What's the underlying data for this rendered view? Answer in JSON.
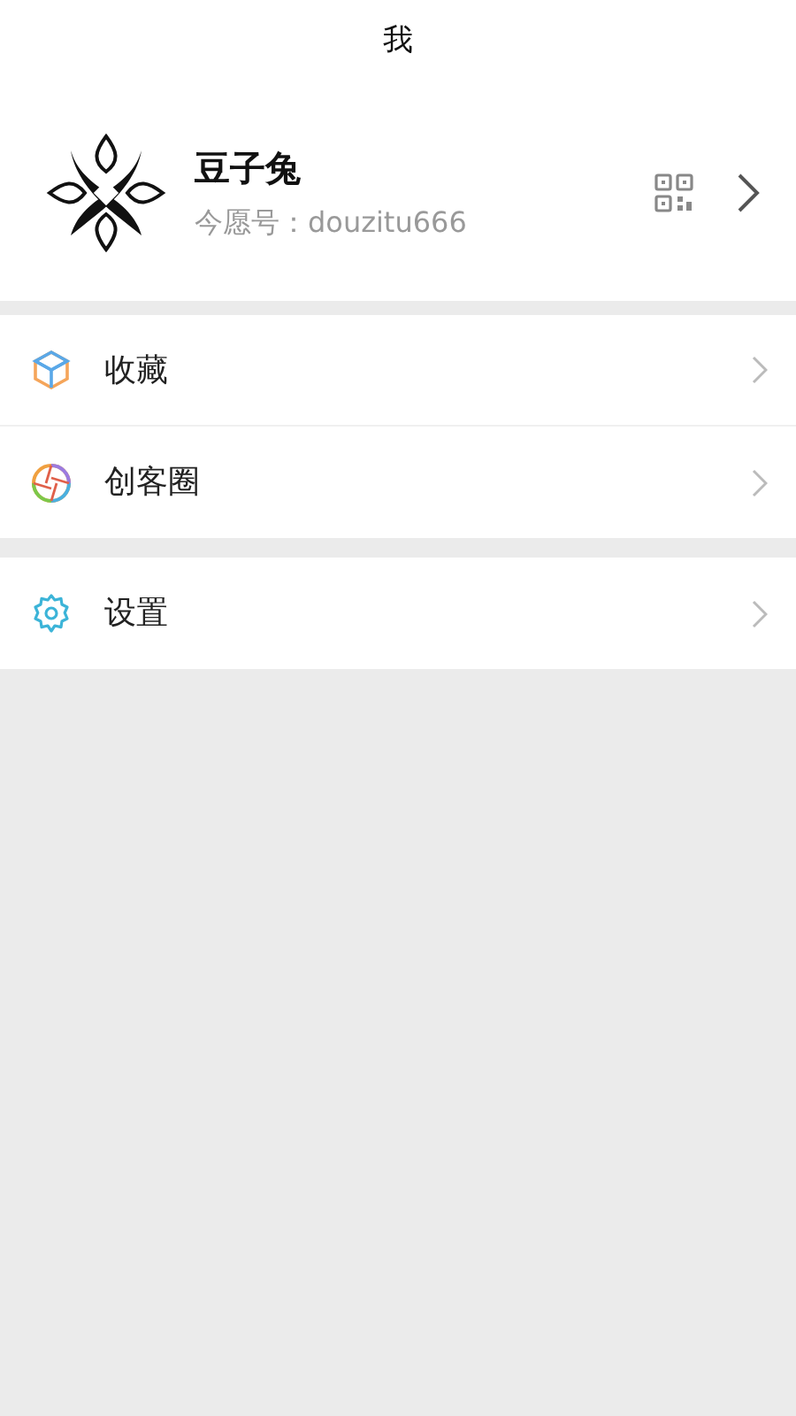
{
  "header": {
    "title": "我"
  },
  "profile": {
    "name": "豆子兔",
    "account": "今愿号：douzitu666"
  },
  "menu_groups": [
    {
      "items": [
        {
          "kind": "cube",
          "label": "收藏"
        },
        {
          "kind": "aperture",
          "label": "创客圈"
        }
      ]
    },
    {
      "items": [
        {
          "kind": "gear",
          "label": "设置"
        }
      ]
    }
  ]
}
